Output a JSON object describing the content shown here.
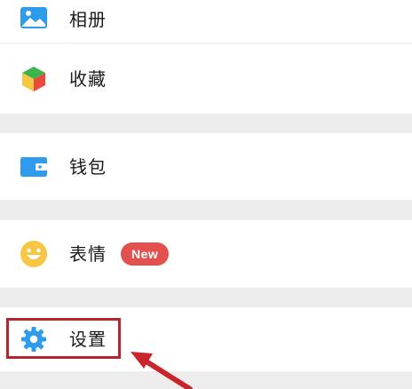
{
  "menu": {
    "items": [
      {
        "label": "相册",
        "icon": "photo-album-icon"
      },
      {
        "label": "收藏",
        "icon": "favorites-cube-icon"
      },
      {
        "label": "钱包",
        "icon": "wallet-icon"
      },
      {
        "label": "表情",
        "icon": "sticker-smiley-icon",
        "badge": "New"
      },
      {
        "label": "设置",
        "icon": "settings-gear-icon"
      }
    ]
  },
  "annotation": {
    "highlight_color": "#b3262d",
    "target": "设置"
  },
  "colors": {
    "background": "#ededed",
    "row": "#ffffff",
    "badge": "#e2514d",
    "icon_blue": "#2f9bec",
    "icon_yellow": "#f7c744"
  }
}
